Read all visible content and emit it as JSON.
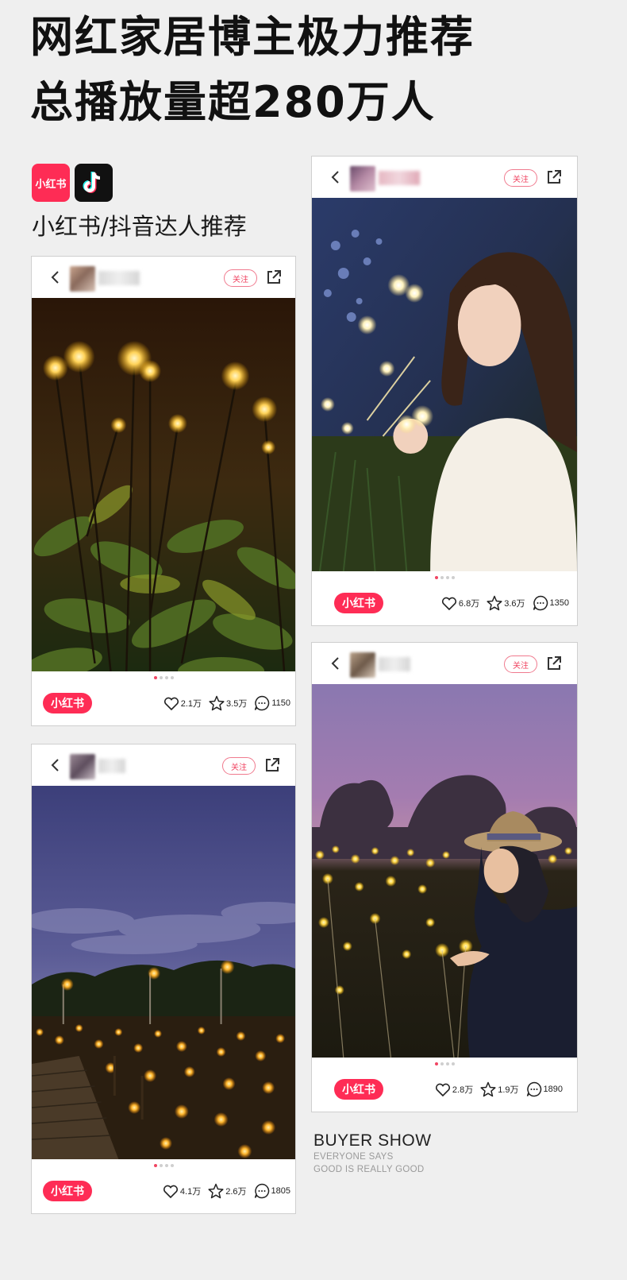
{
  "headline": {
    "line1": "网红家居博主极力推荐",
    "line2": "总播放量超280万人"
  },
  "brands": {
    "xiaohongshu_logo_text": "小红书",
    "douyin_icon": "douyin-note-icon",
    "caption": "小红书/抖音达人推荐"
  },
  "cards": [
    {
      "follow_label": "关注",
      "badge": "小红书",
      "likes": "2.1万",
      "stars": "3.5万",
      "comments": "1150",
      "photo": "garden-firefly-lights-foliage"
    },
    {
      "follow_label": "关注",
      "badge": "小红书",
      "likes": "6.8万",
      "stars": "3.6万",
      "comments": "1350",
      "photo": "girl-holding-firefly-lights"
    },
    {
      "follow_label": "关注",
      "badge": "小红书",
      "likes": "4.1万",
      "stars": "2.6万",
      "comments": "1805",
      "photo": "field-of-firefly-lights-dusk"
    },
    {
      "follow_label": "关注",
      "badge": "小红书",
      "likes": "2.8万",
      "stars": "1.9万",
      "comments": "1890",
      "photo": "woman-with-hat-firefly-field"
    }
  ],
  "buyer_show": {
    "title": "BUYER SHOW",
    "line1": "EVERYONE SAYS",
    "line2": "GOOD IS REALLY GOOD"
  },
  "colors": {
    "accent": "#fe2c55",
    "background": "#efefef"
  }
}
